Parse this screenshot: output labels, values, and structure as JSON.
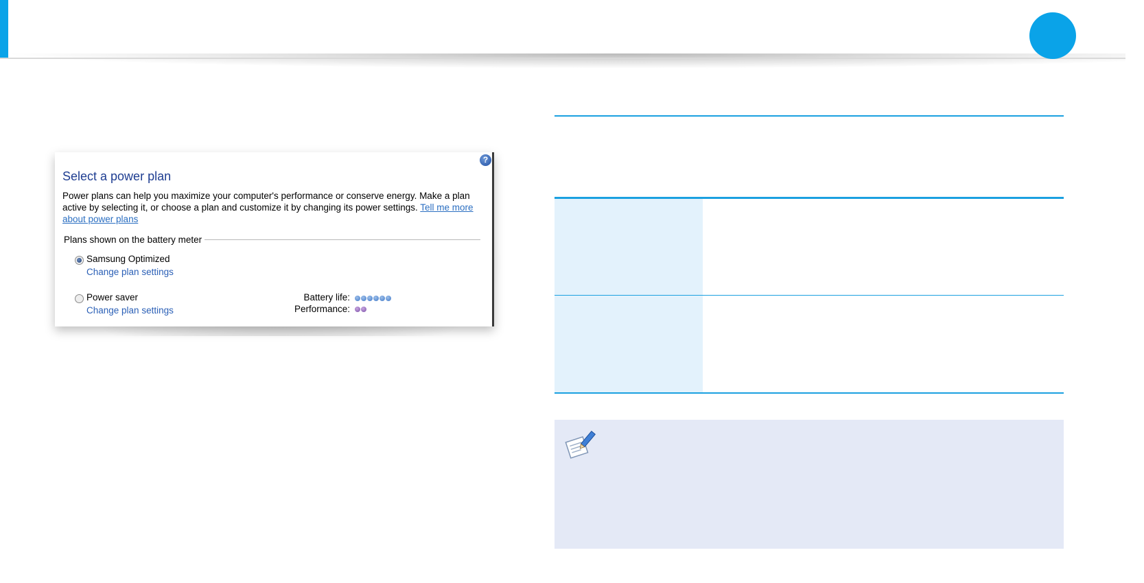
{
  "colors": {
    "accent": "#0aa3e8",
    "rule": "#1aa0e0",
    "table_cell": "#e3f2fc",
    "note_bg": "#e4e9f6",
    "title": "#1e3d91",
    "link": "#2a6ec1"
  },
  "dialog": {
    "help_icon": "question-mark-icon",
    "title": "Select a power plan",
    "description": "Power plans can help you maximize your computer's performance or conserve energy. Make a plan active by selecting it, or choose a plan and customize it by changing its power settings.",
    "more_link": "Tell me more about power plans",
    "group_label": "Plans shown on the battery meter",
    "plans": [
      {
        "name": "Samsung Optimized",
        "selected": true,
        "settings_link": "Change plan settings"
      },
      {
        "name": "Power saver",
        "selected": false,
        "settings_link": "Change plan settings"
      }
    ],
    "meters": {
      "battery_label": "Battery life:",
      "battery_level": 6,
      "performance_label": "Performance:",
      "performance_level": 2
    }
  },
  "note": {
    "icon": "note-pencil-icon"
  }
}
